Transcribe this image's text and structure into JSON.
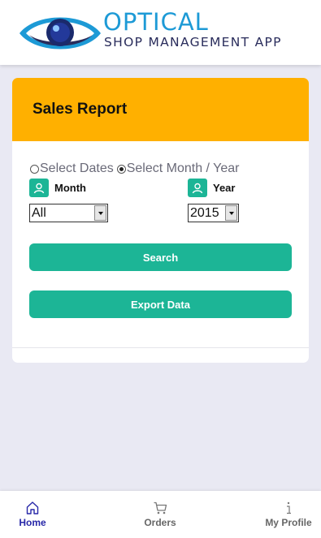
{
  "header": {
    "logo_title": "OPTICAL",
    "logo_subtitle": "SHOP MANAGEMENT APP"
  },
  "report": {
    "title": "Sales Report",
    "filter_options": [
      {
        "label": "Select Dates",
        "selected": false
      },
      {
        "label": "Select Month / Year",
        "selected": true
      }
    ],
    "month_label": "Month",
    "month_value": "All",
    "year_label": "Year",
    "year_value": "2015",
    "search_button": "Search",
    "export_button": "Export Data"
  },
  "nav": {
    "items": [
      {
        "label": "Home",
        "icon": "home-icon",
        "active": true
      },
      {
        "label": "Orders",
        "icon": "cart-icon",
        "active": false
      },
      {
        "label": "My Profile",
        "icon": "info-icon",
        "active": false
      }
    ]
  },
  "colors": {
    "accent": "#1cb596",
    "card_header": "#ffb000",
    "logo_blue": "#1d9ad6",
    "nav_active": "#2727a8",
    "background": "#e9e9f3"
  }
}
